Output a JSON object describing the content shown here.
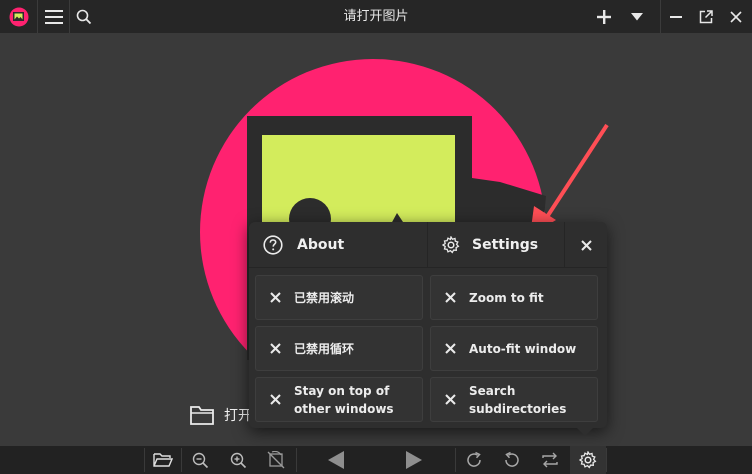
{
  "window": {
    "title": "请打开图片"
  },
  "toolbar": {
    "app_icon": "app-logo-icon",
    "menu_icon": "hamburger-menu-icon",
    "search_icon": "search-icon",
    "add_icon": "plus-icon",
    "dropdown_icon": "caret-down-icon",
    "minimize_icon": "minimize-icon",
    "fullscreen_icon": "external-window-icon",
    "close_icon": "close-icon"
  },
  "main": {
    "open_label": "打开",
    "colors": {
      "circle": "#ff2270",
      "frame": "#2c2c2c",
      "picture": "#d3ec5c",
      "arrow": "#ff4e55"
    }
  },
  "popup": {
    "about_label": "About",
    "settings_label": "Settings",
    "items": [
      {
        "label": "已禁用滚动"
      },
      {
        "label": "Zoom to fit"
      },
      {
        "label": "已禁用循环"
      },
      {
        "label": "Auto-fit window"
      },
      {
        "label": "Stay on top of other windows"
      },
      {
        "label": "Search subdirectories"
      }
    ]
  },
  "bottom_toolbar": {
    "buttons": [
      "open-folder-icon",
      "zoom-out-icon",
      "zoom-in-icon",
      "crop-rotate-icon",
      "previous-icon",
      "next-icon",
      "rotate-right-icon",
      "rotate-left-icon",
      "swap-icon",
      "settings-icon"
    ]
  }
}
